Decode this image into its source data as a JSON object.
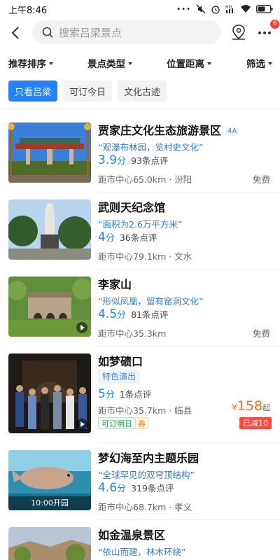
{
  "status_bar": {
    "time": "上午8:46",
    "battery_icon": "battery-icon",
    "signal_icons": [
      "mute-icon",
      "alarm-icon",
      "hd-icon",
      "wifi-icon"
    ]
  },
  "header": {
    "search_placeholder": "搜索吕梁景点",
    "more_badge": "6"
  },
  "filters": [
    "推荐排序",
    "景点类型",
    "位置距离",
    "筛选"
  ],
  "chips": [
    {
      "label": "只看吕梁",
      "active": true
    },
    {
      "label": "可订今日",
      "active": false
    },
    {
      "label": "文化古迹",
      "active": false
    }
  ],
  "colors": {
    "accent": "#2681ff",
    "price": "#ff6a13",
    "score": "#2a7ee0"
  },
  "cards": [
    {
      "title": "贾家庄文化生态旅游景区",
      "level": "4A",
      "quote": "“观瀑布林园，览村史文化”",
      "score": "3.9",
      "score_unit": "分",
      "reviews": "93条点评",
      "distance": "距市中心65.0km · 汾阳",
      "price_note": "免费"
    },
    {
      "title": "武则天纪念馆",
      "quote": "“面积为2.6万平方米”",
      "score": "4",
      "score_unit": "分",
      "reviews": "36条点评",
      "distance": "距市中心79.1km · 文水"
    },
    {
      "title": "李家山",
      "quote": "“形似凤凰，留有窑洞文化”",
      "score": "4.5",
      "score_unit": "分",
      "reviews": "81条点评",
      "distance": "距市中心35.3km",
      "price_note": "免费"
    },
    {
      "title": "如梦碛口",
      "tag": "特色演出",
      "score": "5",
      "score_unit": "分",
      "reviews": "1条点评",
      "distance": "距市中心35.7km · 临县",
      "price_currency": "¥",
      "price_value": "158",
      "price_suffix": "起",
      "book_tag": "可订明日",
      "coupon_tag": "券",
      "reduced": "已减10"
    },
    {
      "title": "梦幻海至内主题乐园",
      "quote": "“全球罕见的双穹顶结构”",
      "score": "4.6",
      "score_unit": "分",
      "reviews": "319条点评",
      "distance": "距市中心68.7km · 孝义",
      "open_time": "10:00开园"
    },
    {
      "title": "如金温泉景区",
      "quote": "“依山而建，林木环绕”"
    }
  ]
}
